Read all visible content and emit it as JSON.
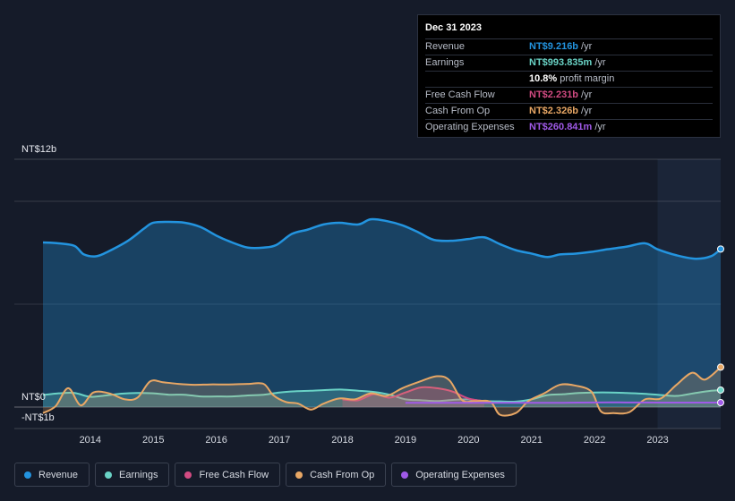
{
  "tooltip": {
    "date": "Dec 31 2023",
    "rows": [
      {
        "name": "Revenue",
        "value": "NT$9.216b",
        "unit": "/yr",
        "color": "#2394df"
      },
      {
        "name": "Earnings",
        "value": "NT$993.835m",
        "unit": "/yr",
        "color": "#6ad3c6"
      },
      {
        "name": "",
        "value": "10.8%",
        "unit": "profit margin",
        "color": "#ffffff"
      },
      {
        "name": "Free Cash Flow",
        "value": "NT$2.231b",
        "unit": "/yr",
        "color": "#d24b82"
      },
      {
        "name": "Cash From Op",
        "value": "NT$2.326b",
        "unit": "/yr",
        "color": "#e8a765"
      },
      {
        "name": "Operating Expenses",
        "value": "NT$260.841m",
        "unit": "/yr",
        "color": "#a05ae8"
      }
    ]
  },
  "legend": [
    {
      "label": "Revenue",
      "color": "#2394df"
    },
    {
      "label": "Earnings",
      "color": "#6ad3c6"
    },
    {
      "label": "Free Cash Flow",
      "color": "#d24b82"
    },
    {
      "label": "Cash From Op",
      "color": "#e8a765"
    },
    {
      "label": "Operating Expenses",
      "color": "#a05ae8"
    }
  ],
  "chart_data": {
    "type": "area",
    "y_tick_labels": [
      "NT$12b",
      "NT$0",
      "-NT$1b"
    ],
    "ylim": [
      -1,
      12
    ],
    "xlim": [
      2013.25,
      2024.0
    ],
    "x_ticks": [
      2014,
      2015,
      2016,
      2017,
      2018,
      2019,
      2020,
      2021,
      2022,
      2023
    ],
    "grid": true,
    "forecast_shade_start": 2023.0,
    "series": [
      {
        "name": "Revenue",
        "color": "#2394df",
        "fill": true,
        "points": [
          [
            2013.25,
            9.6
          ],
          [
            2013.5,
            9.55
          ],
          [
            2013.75,
            9.4
          ],
          [
            2013.9,
            8.9
          ],
          [
            2014.1,
            8.8
          ],
          [
            2014.3,
            9.1
          ],
          [
            2014.6,
            9.7
          ],
          [
            2014.85,
            10.4
          ],
          [
            2015.0,
            10.75
          ],
          [
            2015.25,
            10.8
          ],
          [
            2015.5,
            10.75
          ],
          [
            2015.75,
            10.5
          ],
          [
            2016.0,
            10.0
          ],
          [
            2016.25,
            9.6
          ],
          [
            2016.5,
            9.3
          ],
          [
            2016.75,
            9.3
          ],
          [
            2016.95,
            9.45
          ],
          [
            2017.2,
            10.1
          ],
          [
            2017.45,
            10.35
          ],
          [
            2017.7,
            10.65
          ],
          [
            2017.95,
            10.75
          ],
          [
            2018.25,
            10.65
          ],
          [
            2018.45,
            10.95
          ],
          [
            2018.7,
            10.85
          ],
          [
            2018.95,
            10.6
          ],
          [
            2019.2,
            10.2
          ],
          [
            2019.45,
            9.75
          ],
          [
            2019.75,
            9.7
          ],
          [
            2020.0,
            9.8
          ],
          [
            2020.25,
            9.9
          ],
          [
            2020.5,
            9.5
          ],
          [
            2020.75,
            9.15
          ],
          [
            2021.0,
            8.95
          ],
          [
            2021.25,
            8.75
          ],
          [
            2021.45,
            8.9
          ],
          [
            2021.7,
            8.95
          ],
          [
            2021.95,
            9.05
          ],
          [
            2022.2,
            9.2
          ],
          [
            2022.5,
            9.35
          ],
          [
            2022.8,
            9.55
          ],
          [
            2023.0,
            9.2
          ],
          [
            2023.3,
            8.85
          ],
          [
            2023.6,
            8.65
          ],
          [
            2023.85,
            8.8
          ],
          [
            2024.0,
            9.216
          ]
        ]
      },
      {
        "name": "Earnings",
        "color": "#6ad3c6",
        "fill": true,
        "points": [
          [
            2013.25,
            0.7
          ],
          [
            2013.5,
            0.8
          ],
          [
            2013.75,
            0.82
          ],
          [
            2014.0,
            0.6
          ],
          [
            2014.25,
            0.68
          ],
          [
            2014.5,
            0.78
          ],
          [
            2014.75,
            0.82
          ],
          [
            2015.0,
            0.8
          ],
          [
            2015.25,
            0.72
          ],
          [
            2015.5,
            0.72
          ],
          [
            2015.75,
            0.62
          ],
          [
            2016.0,
            0.62
          ],
          [
            2016.25,
            0.62
          ],
          [
            2016.5,
            0.68
          ],
          [
            2016.75,
            0.72
          ],
          [
            2017.0,
            0.85
          ],
          [
            2017.25,
            0.92
          ],
          [
            2017.5,
            0.95
          ],
          [
            2017.75,
            1.0
          ],
          [
            2018.0,
            1.02
          ],
          [
            2018.25,
            0.95
          ],
          [
            2018.5,
            0.88
          ],
          [
            2018.75,
            0.72
          ],
          [
            2019.0,
            0.45
          ],
          [
            2019.25,
            0.4
          ],
          [
            2019.5,
            0.35
          ],
          [
            2019.75,
            0.42
          ],
          [
            2020.0,
            0.45
          ],
          [
            2020.25,
            0.35
          ],
          [
            2020.5,
            0.33
          ],
          [
            2020.75,
            0.32
          ],
          [
            2021.0,
            0.45
          ],
          [
            2021.25,
            0.7
          ],
          [
            2021.5,
            0.75
          ],
          [
            2021.75,
            0.82
          ],
          [
            2022.0,
            0.85
          ],
          [
            2022.25,
            0.85
          ],
          [
            2022.5,
            0.82
          ],
          [
            2022.75,
            0.78
          ],
          [
            2023.0,
            0.72
          ],
          [
            2023.3,
            0.65
          ],
          [
            2023.6,
            0.82
          ],
          [
            2023.85,
            0.95
          ],
          [
            2024.0,
            0.994
          ]
        ]
      },
      {
        "name": "Free Cash Flow",
        "color": "#d24b82",
        "fill": true,
        "points": [
          [
            2018.0,
            0.45
          ],
          [
            2018.25,
            0.4
          ],
          [
            2018.5,
            0.75
          ],
          [
            2018.75,
            0.55
          ],
          [
            2019.0,
            0.85
          ],
          [
            2019.25,
            1.15
          ],
          [
            2019.5,
            1.1
          ],
          [
            2019.75,
            0.9
          ],
          [
            2020.0,
            0.5
          ],
          [
            2020.25,
            0.35
          ]
        ]
      },
      {
        "name": "Cash From Op",
        "color": "#e8a765",
        "fill": true,
        "points": [
          [
            2013.25,
            -0.35
          ],
          [
            2013.45,
            0.05
          ],
          [
            2013.65,
            1.1
          ],
          [
            2013.85,
            0.1
          ],
          [
            2014.05,
            0.85
          ],
          [
            2014.3,
            0.8
          ],
          [
            2014.55,
            0.45
          ],
          [
            2014.75,
            0.55
          ],
          [
            2014.95,
            1.5
          ],
          [
            2015.15,
            1.45
          ],
          [
            2015.4,
            1.35
          ],
          [
            2015.65,
            1.3
          ],
          [
            2015.9,
            1.32
          ],
          [
            2016.2,
            1.32
          ],
          [
            2016.5,
            1.35
          ],
          [
            2016.75,
            1.35
          ],
          [
            2016.9,
            0.7
          ],
          [
            2017.1,
            0.3
          ],
          [
            2017.3,
            0.2
          ],
          [
            2017.5,
            -0.15
          ],
          [
            2017.7,
            0.2
          ],
          [
            2017.95,
            0.5
          ],
          [
            2018.2,
            0.45
          ],
          [
            2018.45,
            0.8
          ],
          [
            2018.7,
            0.65
          ],
          [
            2018.95,
            1.1
          ],
          [
            2019.2,
            1.45
          ],
          [
            2019.5,
            1.8
          ],
          [
            2019.7,
            1.55
          ],
          [
            2019.9,
            0.4
          ],
          [
            2020.1,
            0.35
          ],
          [
            2020.35,
            0.3
          ],
          [
            2020.5,
            -0.45
          ],
          [
            2020.75,
            -0.35
          ],
          [
            2020.95,
            0.35
          ],
          [
            2021.2,
            0.8
          ],
          [
            2021.45,
            1.3
          ],
          [
            2021.7,
            1.25
          ],
          [
            2021.95,
            0.9
          ],
          [
            2022.1,
            -0.25
          ],
          [
            2022.3,
            -0.35
          ],
          [
            2022.55,
            -0.3
          ],
          [
            2022.8,
            0.45
          ],
          [
            2023.05,
            0.5
          ],
          [
            2023.3,
            1.3
          ],
          [
            2023.55,
            2.0
          ],
          [
            2023.75,
            1.6
          ],
          [
            2024.0,
            2.326
          ]
        ]
      },
      {
        "name": "Operating Expenses",
        "color": "#a05ae8",
        "fill": false,
        "points": [
          [
            2019.0,
            0.25
          ],
          [
            2019.5,
            0.25
          ],
          [
            2020.0,
            0.25
          ],
          [
            2020.5,
            0.25
          ],
          [
            2021.0,
            0.25
          ],
          [
            2021.5,
            0.25
          ],
          [
            2022.0,
            0.27
          ],
          [
            2022.5,
            0.27
          ],
          [
            2023.0,
            0.26
          ],
          [
            2023.5,
            0.26
          ],
          [
            2024.0,
            0.261
          ]
        ]
      }
    ]
  }
}
